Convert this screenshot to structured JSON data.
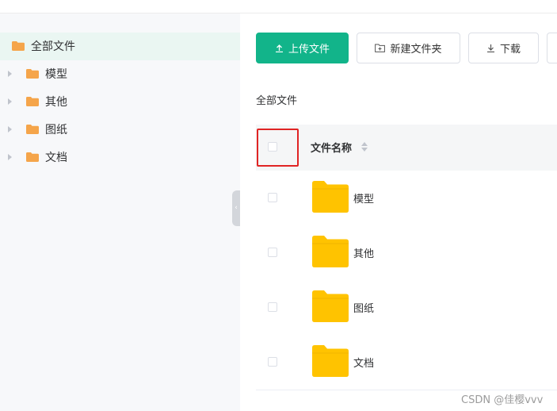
{
  "sidebar": {
    "root_label": "全部文件",
    "items": [
      {
        "label": "模型"
      },
      {
        "label": "其他"
      },
      {
        "label": "图纸"
      },
      {
        "label": "文档"
      }
    ]
  },
  "toolbar": {
    "upload_label": "上传文件",
    "new_folder_label": "新建文件夹",
    "download_label": "下载"
  },
  "breadcrumb": "全部文件",
  "table": {
    "header_name": "文件名称",
    "rows": [
      {
        "name": "模型"
      },
      {
        "name": "其他"
      },
      {
        "name": "图纸"
      },
      {
        "name": "文档"
      }
    ]
  },
  "watermark": "CSDN @佳樱vvv",
  "colors": {
    "accent": "#12b48a",
    "folder_tree": "#f5a54a",
    "folder_large": "#ffc300",
    "highlight_box": "#e02424"
  }
}
